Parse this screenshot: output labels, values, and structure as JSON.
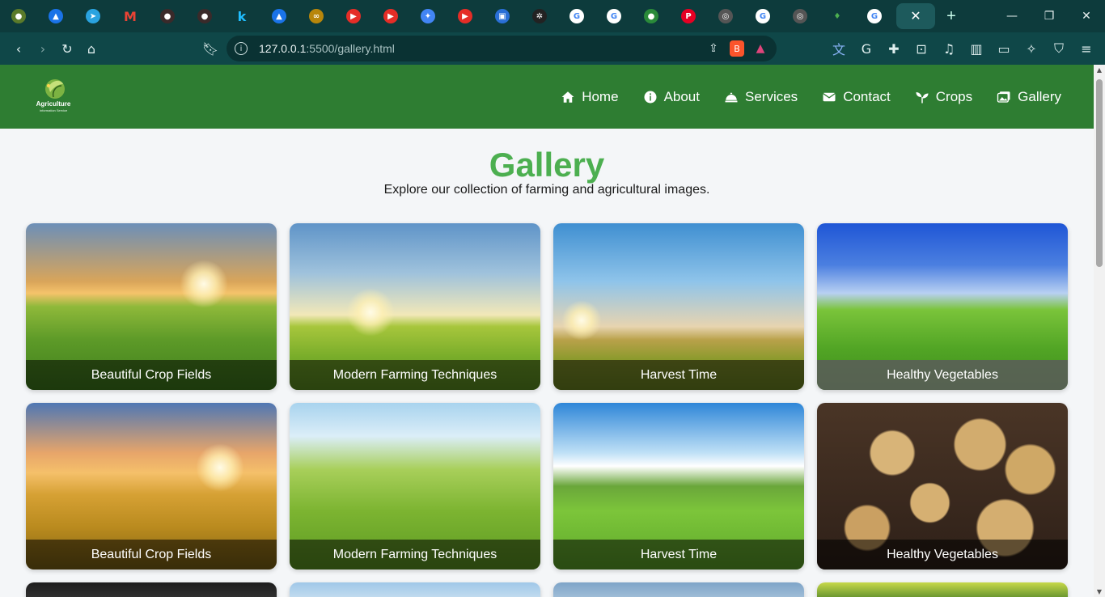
{
  "browser": {
    "url_host": "127.0.0.1",
    "url_path": ":5500/gallery.html",
    "tab_close": "✕",
    "new_tab": "+"
  },
  "nav": {
    "items": [
      {
        "label": "Home",
        "icon": "home-icon"
      },
      {
        "label": "About",
        "icon": "info-icon"
      },
      {
        "label": "Services",
        "icon": "service-bell-icon"
      },
      {
        "label": "Contact",
        "icon": "envelope-icon"
      },
      {
        "label": "Crops",
        "icon": "seedling-icon"
      },
      {
        "label": "Gallery",
        "icon": "images-icon"
      }
    ]
  },
  "logo": {
    "line1": "Agriculture",
    "line2": "Information Service"
  },
  "gallery": {
    "title": "Gallery",
    "subtitle": "Explore our collection of farming and agricultural images.",
    "cards": [
      {
        "caption": "Beautiful Crop Fields"
      },
      {
        "caption": "Modern Farming Techniques"
      },
      {
        "caption": "Harvest Time"
      },
      {
        "caption": "Healthy Vegetables"
      },
      {
        "caption": "Beautiful Crop Fields"
      },
      {
        "caption": "Modern Farming Techniques"
      },
      {
        "caption": "Harvest Time"
      },
      {
        "caption": "Healthy Vegetables"
      }
    ]
  },
  "colors": {
    "header_green": "#2e7d32",
    "title_green": "#4caf50",
    "browser_tabstrip": "#0d3b3c",
    "browser_toolbar": "#0f4748"
  }
}
